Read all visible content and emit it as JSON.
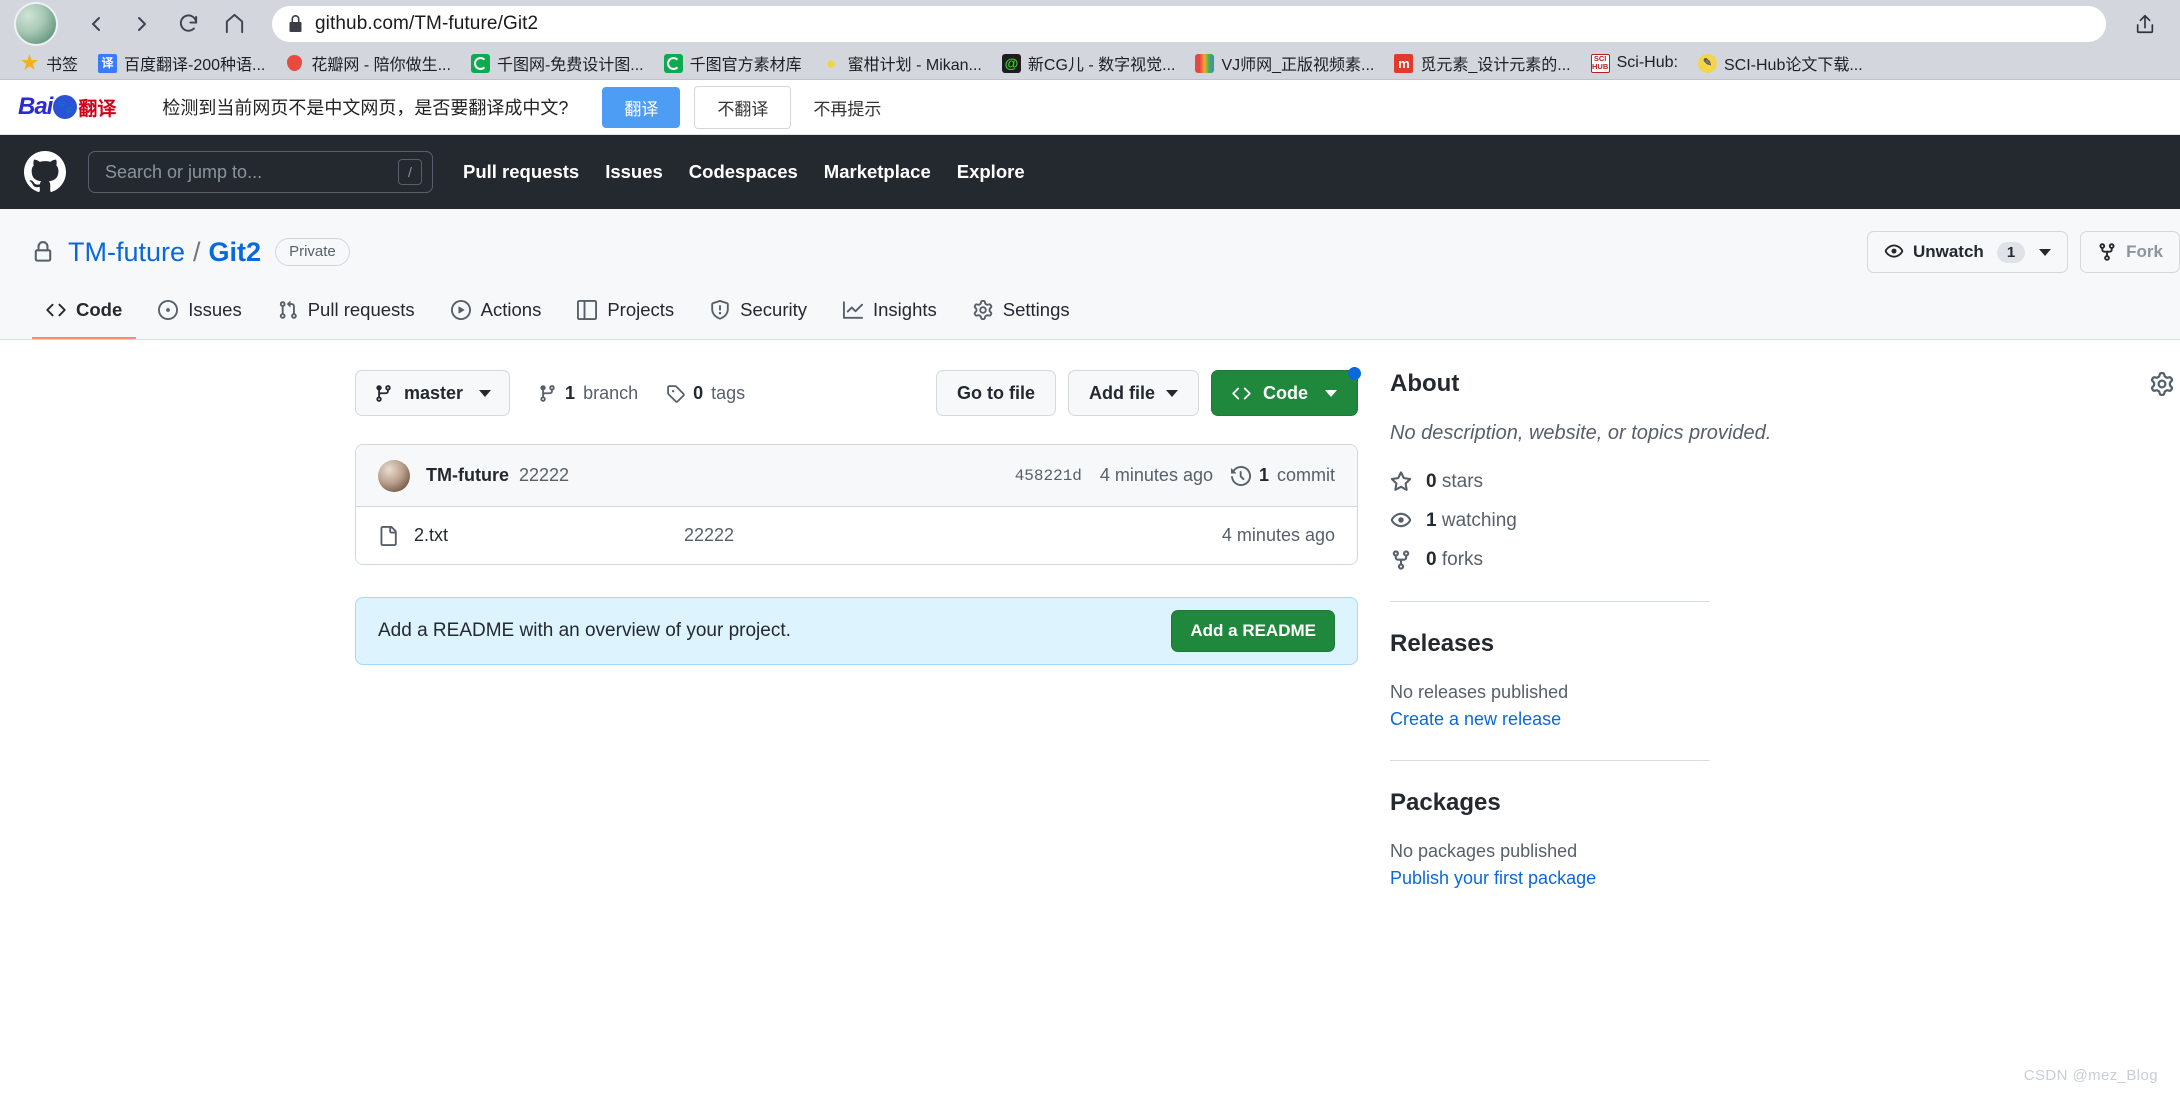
{
  "browser": {
    "url": "github.com/TM-future/Git2",
    "back_label": "Back",
    "forward_label": "Forward",
    "reload_label": "Reload",
    "home_label": "Home",
    "share_label": "Share",
    "lock_icon": "lock-icon",
    "bookmarks": [
      {
        "label": "书签",
        "icon": "star-icon"
      },
      {
        "label": "百度翻译-200种语...",
        "icon": "baidu-translate-icon"
      },
      {
        "label": "花瓣网 - 陪你做生...",
        "icon": "huaban-icon"
      },
      {
        "label": "千图网-免费设计图...",
        "icon": "qiantu-icon"
      },
      {
        "label": "千图官方素材库",
        "icon": "qiantu-icon"
      },
      {
        "label": "蜜柑计划 - Mikan...",
        "icon": "mikan-icon"
      },
      {
        "label": "新CG儿 - 数字视觉...",
        "icon": "newcg-icon"
      },
      {
        "label": "VJ师网_正版视频素...",
        "icon": "vjshi-icon"
      },
      {
        "label": "觅元素_设计元素的...",
        "icon": "miyuansu-icon"
      },
      {
        "label": "Sci-Hub:",
        "icon": "scihub-icon"
      },
      {
        "label": "SCI-Hub论文下载...",
        "icon": "scihub-download-icon"
      }
    ]
  },
  "translate_bar": {
    "logo_bai": "Bai",
    "logo_fanyi": "翻译",
    "question": "检测到当前网页不是中文网页，是否要翻译成中文?",
    "translate_button": "翻译",
    "no_translate_button": "不翻译",
    "never_link": "不再提示"
  },
  "gh_header": {
    "logo": "github-logo",
    "search_placeholder": "Search or jump to...",
    "search_value": "",
    "slash_key": "/",
    "nav": [
      {
        "label": "Pull requests"
      },
      {
        "label": "Issues"
      },
      {
        "label": "Codespaces"
      },
      {
        "label": "Marketplace"
      },
      {
        "label": "Explore"
      }
    ]
  },
  "repo": {
    "owner": "TM-future",
    "separator": "/",
    "name": "Git2",
    "visibility": "Private",
    "unwatch_label": "Unwatch",
    "unwatch_count": "1",
    "fork_label": "Fork",
    "tabs": [
      {
        "label": "Code",
        "icon": "code-icon",
        "selected": true
      },
      {
        "label": "Issues",
        "icon": "issue-opened-icon",
        "selected": false
      },
      {
        "label": "Pull requests",
        "icon": "git-pull-request-icon",
        "selected": false
      },
      {
        "label": "Actions",
        "icon": "play-icon",
        "selected": false
      },
      {
        "label": "Projects",
        "icon": "table-icon",
        "selected": false
      },
      {
        "label": "Security",
        "icon": "shield-icon",
        "selected": false
      },
      {
        "label": "Insights",
        "icon": "graph-icon",
        "selected": false
      },
      {
        "label": "Settings",
        "icon": "gear-icon",
        "selected": false
      }
    ]
  },
  "toolbar": {
    "branch_name": "master",
    "branch_count": "1",
    "branch_word": "branch",
    "tag_count": "0",
    "tag_word": "tags",
    "go_to_file": "Go to file",
    "add_file": "Add file",
    "code": "Code"
  },
  "commit": {
    "author": "TM-future",
    "message": "22222",
    "sha": "458221d",
    "time": "4 minutes ago",
    "count": "1",
    "count_word": "commit"
  },
  "files": [
    {
      "name": "2.txt",
      "commit_message": "22222",
      "time": "4 minutes ago",
      "icon": "file-icon"
    }
  ],
  "readme_banner": {
    "text": "Add a README with an overview of your project.",
    "button": "Add a README"
  },
  "sidebar": {
    "about": {
      "title": "About",
      "description": "No description, website, or topics provided.",
      "stats": [
        {
          "count": "0",
          "label": "stars",
          "icon": "star-icon"
        },
        {
          "count": "1",
          "label": "watching",
          "icon": "eye-icon"
        },
        {
          "count": "0",
          "label": "forks",
          "icon": "repo-forked-icon"
        }
      ]
    },
    "releases": {
      "title": "Releases",
      "empty": "No releases published",
      "link": "Create a new release"
    },
    "packages": {
      "title": "Packages",
      "empty": "No packages published",
      "link": "Publish your first package"
    }
  },
  "watermark": "CSDN @mez_Blog",
  "colors": {
    "accent": "#0969da",
    "green": "#1f883d",
    "header_bg": "#24292f",
    "tab_underline": "#fd8c73",
    "banner_bg": "#ddf4ff"
  }
}
